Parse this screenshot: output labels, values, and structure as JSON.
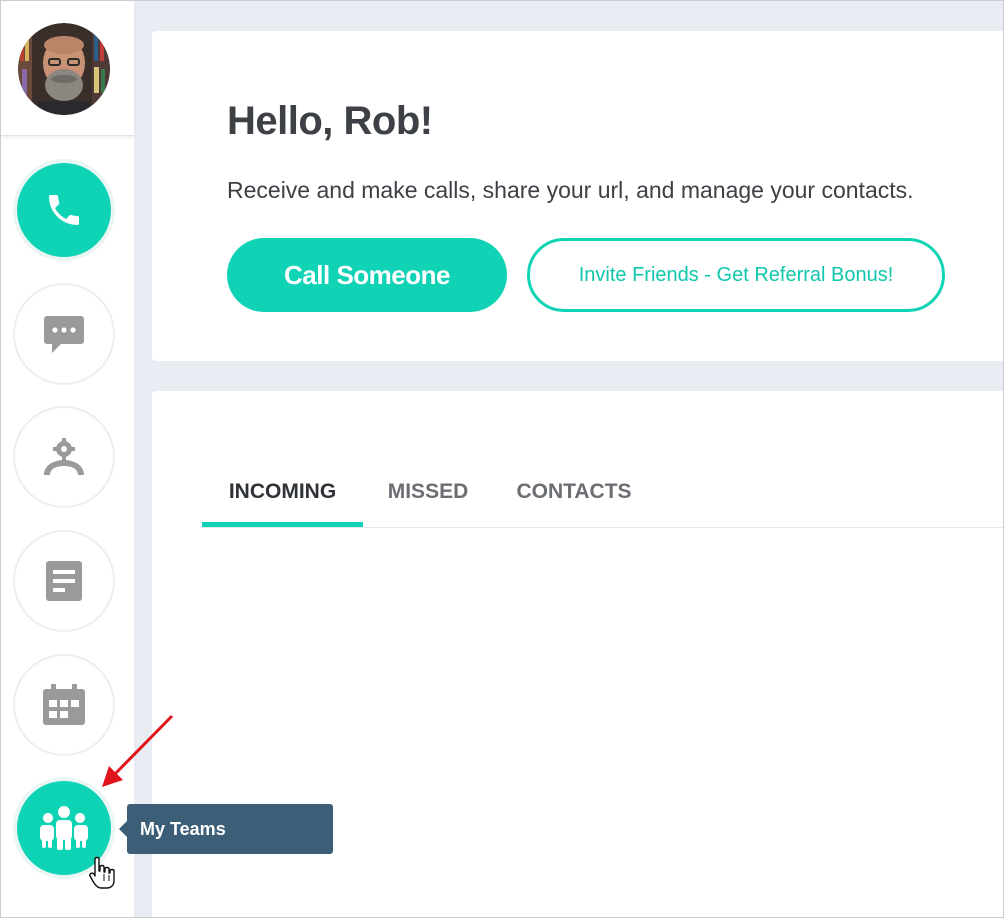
{
  "greeting": "Hello, Rob!",
  "subtitle": "Receive and make calls, share your url, and manage your contacts.",
  "buttons": {
    "primary": "Call Someone",
    "secondary": "Invite Friends - Get Referral Bonus!"
  },
  "tabs": [
    {
      "label": "INCOMING",
      "active": true
    },
    {
      "label": "MISSED",
      "active": false
    },
    {
      "label": "CONTACTS",
      "active": false
    }
  ],
  "sidebar": {
    "items": [
      {
        "icon": "phone-icon",
        "active": true
      },
      {
        "icon": "chat-icon",
        "active": false
      },
      {
        "icon": "user-settings-icon",
        "active": false
      },
      {
        "icon": "document-icon",
        "active": false
      },
      {
        "icon": "calendar-icon",
        "active": false
      },
      {
        "icon": "teams-icon",
        "active": true
      }
    ]
  },
  "tooltip": {
    "label": "My Teams"
  },
  "colors": {
    "accent": "#10d3b6",
    "tooltip_bg": "#3c5f77",
    "text_dark": "#3d4045",
    "icon_gray": "#9a9a9a",
    "annotation_arrow": "#e0141b"
  }
}
